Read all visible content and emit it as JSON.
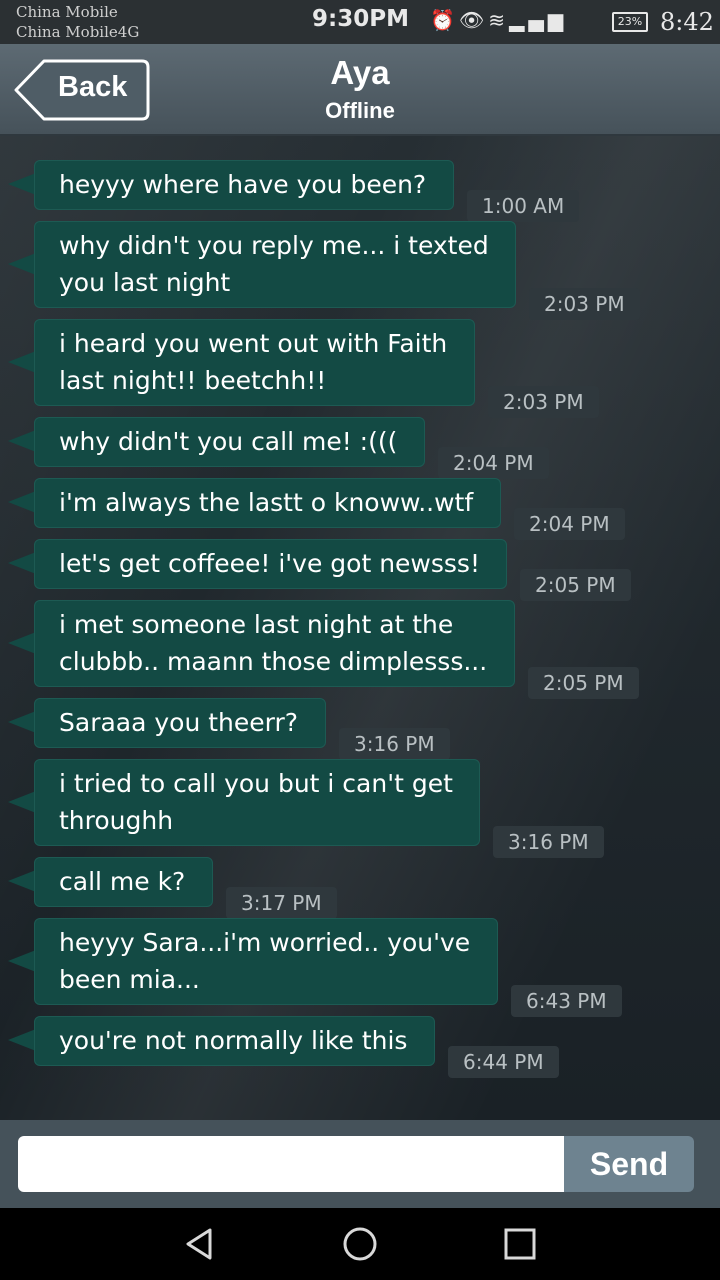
{
  "status_bar": {
    "carrier_1": "China Mobile",
    "carrier_2": "China Mobile4G",
    "time": "9:30PM",
    "battery": "23%",
    "clock": "8:42"
  },
  "header": {
    "back_label": "Back",
    "title": "Aya",
    "subtitle": "Offline"
  },
  "messages": [
    {
      "text": "heyyy where have you been?",
      "time": "1:00 AM"
    },
    {
      "text": "why didn't you reply me... i texted\nyou last night",
      "time": "2:03 PM"
    },
    {
      "text": "i heard you went out with Faith\nlast night!! beetchh!!",
      "time": "2:03 PM"
    },
    {
      "text": "why didn't you call me! :(((",
      "time": "2:04 PM"
    },
    {
      "text": "i'm always the lastt o knoww..wtf",
      "time": "2:04 PM"
    },
    {
      "text": "let's get coffeee! i've got newsss!",
      "time": "2:05 PM"
    },
    {
      "text": "i met someone last night at the\nclubbb.. maann those dimplesss...",
      "time": "2:05 PM"
    },
    {
      "text": "Saraaa you theerr?",
      "time": "3:16 PM"
    },
    {
      "text": "i tried to call you but i can't get\nthroughh",
      "time": "3:16 PM"
    },
    {
      "text": "call me k?",
      "time": "3:17 PM"
    },
    {
      "text": "heyyy Sara...i'm worried.. you've\nbeen mia...",
      "time": "6:43 PM"
    },
    {
      "text": "you're not normally like this",
      "time": "6:44 PM"
    }
  ],
  "input": {
    "value": "",
    "send_label": "Send"
  },
  "colors": {
    "bubble": "#134a44",
    "header": "#55626b",
    "send_button": "#6e8390"
  },
  "icons": [
    "back-arrow-icon",
    "home-circle-icon",
    "recents-square-icon"
  ]
}
